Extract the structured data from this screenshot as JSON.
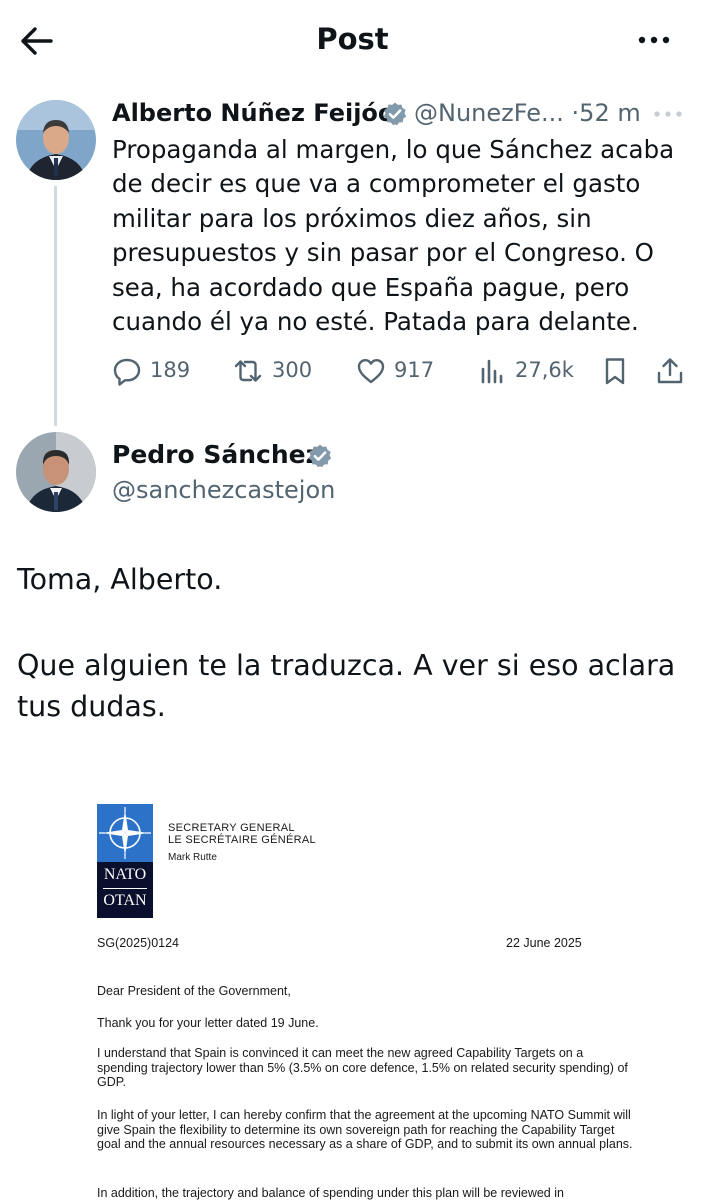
{
  "header": {
    "title": "Post",
    "back_icon": "arrow-left-icon",
    "more_icon": "more-vertical-icon"
  },
  "tweet1": {
    "display_name": "Alberto Núñez Feijóo",
    "handle": "@NunezFe...",
    "separator": "·",
    "time": "52 m",
    "text": "Propaganda al margen, lo que Sánchez acaba de decir es que va a comprometer el gasto militar para los próximos diez años, sin presupuestos y sin pasar por el Congreso. O sea, ha acordado que España pague, pero cuando él ya no esté. Patada para delante.",
    "actions": {
      "replies": "189",
      "reposts": "300",
      "likes": "917",
      "views": "27,6k"
    }
  },
  "tweet2": {
    "display_name": "Pedro Sánchez",
    "handle": "@sanchezcastejon",
    "text_line1": "Toma, Alberto.",
    "text_line2": "Que alguien te la traduzca. A ver si eso aclara tus dudas."
  },
  "letter": {
    "logo_top": "NATO",
    "logo_bottom": "OTAN",
    "office_en": "SECRETARY GENERAL",
    "office_fr": "LE SECRÉTAIRE GÉNÉRAL",
    "signatory": "Mark Rutte",
    "reference": "SG(2025)0124",
    "date": "22 June 2025",
    "salutation": "Dear President of the Government,",
    "p1": "Thank you for your letter dated 19 June.",
    "p2": "I understand that Spain is convinced it can meet the new agreed Capability Targets on a spending trajectory lower than 5% (3.5% on core defence, 1.5% on related security spending) of GDP.",
    "p3": "In light of your letter, I can hereby confirm that the agreement at the upcoming NATO Summit will give Spain the flexibility to determine its own sovereign path for reaching the Capability Target goal and the annual resources necessary as a share of GDP, and to submit its own annual plans.",
    "p4": "In addition, the trajectory and balance of spending under this plan will be reviewed in"
  },
  "colors": {
    "text": "#0f1419",
    "secondary": "#536471",
    "verified": "#829aab",
    "thread_line": "#cfd9de",
    "nato_blue": "#2d72c9",
    "nato_navy": "#0a0f2e"
  }
}
